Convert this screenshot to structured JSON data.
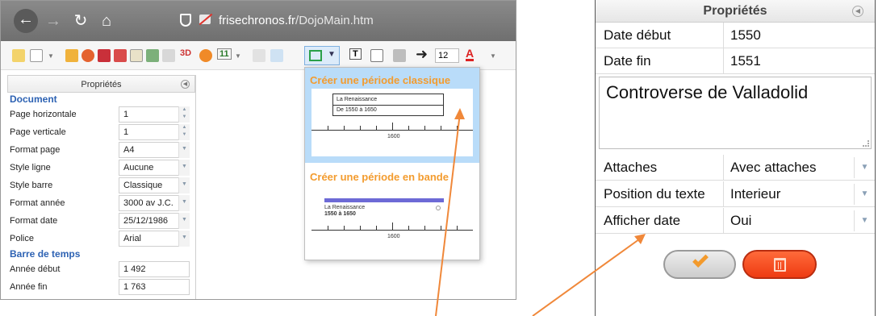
{
  "browser": {
    "url_domain": "frisechronos.fr",
    "url_path": "/DojoMain.htm",
    "toolbar": {
      "text_button": "T",
      "font_size": "12",
      "color_button": "A",
      "three_d": "3D",
      "link_label": "11"
    },
    "properties": {
      "header": "Propriétés",
      "sections": {
        "document": "Document",
        "timebar": "Barre de temps"
      },
      "document_rows": [
        {
          "label": "Page horizontale",
          "value": "1",
          "control": "spin"
        },
        {
          "label": "Page verticale",
          "value": "1",
          "control": "spin"
        },
        {
          "label": "Format page",
          "value": "A4",
          "control": "select"
        },
        {
          "label": "Style ligne",
          "value": "Aucune",
          "control": "select"
        },
        {
          "label": "Style barre",
          "value": "Classique",
          "control": "select"
        },
        {
          "label": "Format année",
          "value": "3000 av J.C.",
          "control": "select"
        },
        {
          "label": "Format date",
          "value": "25/12/1986",
          "control": "select"
        },
        {
          "label": "Police",
          "value": "Arial",
          "control": "select"
        }
      ],
      "timebar_rows": [
        {
          "label": "Année début",
          "value": "1 492"
        },
        {
          "label": "Année fin",
          "value": "1 763"
        }
      ]
    },
    "dropdown": {
      "item1": {
        "title": "Créer une période classique",
        "preview_line1": "La Renaissance",
        "preview_line2": "De 1550 à 1650",
        "ruler_label": "1600"
      },
      "item2": {
        "title": "Créer une période en bande",
        "preview_line1": "La Renaissance",
        "preview_line2": "1550 à 1650",
        "ruler_label": "1600"
      }
    }
  },
  "zoom_panel": {
    "header": "Propriétés",
    "date_debut": {
      "label": "Date début",
      "value": "1550"
    },
    "date_fin": {
      "label": "Date fin",
      "value": "1551"
    },
    "description": "Controverse de Valladolid",
    "attaches": {
      "label": "Attaches",
      "value": "Avec attaches"
    },
    "position_texte": {
      "label": "Position du texte",
      "value": "Interieur"
    },
    "afficher_date": {
      "label": "Afficher date",
      "value": "Oui"
    }
  },
  "colors": {
    "accent_orange": "#f39c2f",
    "section_blue": "#2d62b3",
    "selected_item_bg": "#b9dcf9",
    "delete_red": "#ee3b12"
  }
}
